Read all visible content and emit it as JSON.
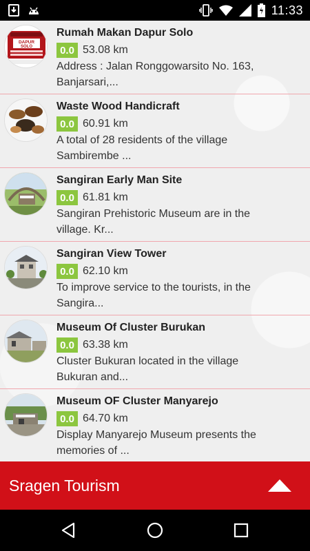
{
  "status_bar": {
    "time": "11:33",
    "left_icons": [
      "download-icon",
      "android-icon"
    ],
    "right_icons": [
      "vibrate-icon",
      "wifi-icon",
      "signal-icon",
      "battery-icon"
    ]
  },
  "places": [
    {
      "title": "Rumah Makan Dapur Solo",
      "rating": "0.0",
      "distance": "53.08 km",
      "desc_line1": "Address : Jalan Ronggowarsito No. 163,",
      "desc_line2": "Banjarsari,..."
    },
    {
      "title": "Waste Wood Handicraft",
      "rating": "0.0",
      "distance": "60.91 km",
      "desc_line1": "A total of 28 residents of the village",
      "desc_line2": "Sambirembe ..."
    },
    {
      "title": "Sangiran Early Man Site",
      "rating": "0.0",
      "distance": "61.81 km",
      "desc_line1": "Sangiran Prehistoric Museum are in the",
      "desc_line2": "village. Kr..."
    },
    {
      "title": "Sangiran View Tower",
      "rating": "0.0",
      "distance": "62.10 km",
      "desc_line1": "To improve service to the tourists, in the",
      "desc_line2": "Sangira..."
    },
    {
      "title": "Museum Of Cluster Burukan",
      "rating": "0.0",
      "distance": "63.38 km",
      "desc_line1": "Cluster Bukuran located in the village",
      "desc_line2": "Bukuran and..."
    },
    {
      "title": "Museum OF Cluster Manyarejo",
      "rating": "0.0",
      "distance": "64.70 km",
      "desc_line1": "Display Manyarejo Museum presents the",
      "desc_line2": "memories of ..."
    }
  ],
  "thumbnail_logo": {
    "line1": "DAPUR",
    "line2": "SOLO"
  },
  "app_bar": {
    "title": "Sragen Tourism",
    "expand_icon": "triangle-up-icon"
  },
  "nav_bar": {
    "icons": [
      "back-icon",
      "home-icon",
      "recents-icon"
    ]
  },
  "colors": {
    "accent_red": "#d11018",
    "rating_green": "#8cc63f",
    "divider_pink": "#f0a6ad"
  }
}
